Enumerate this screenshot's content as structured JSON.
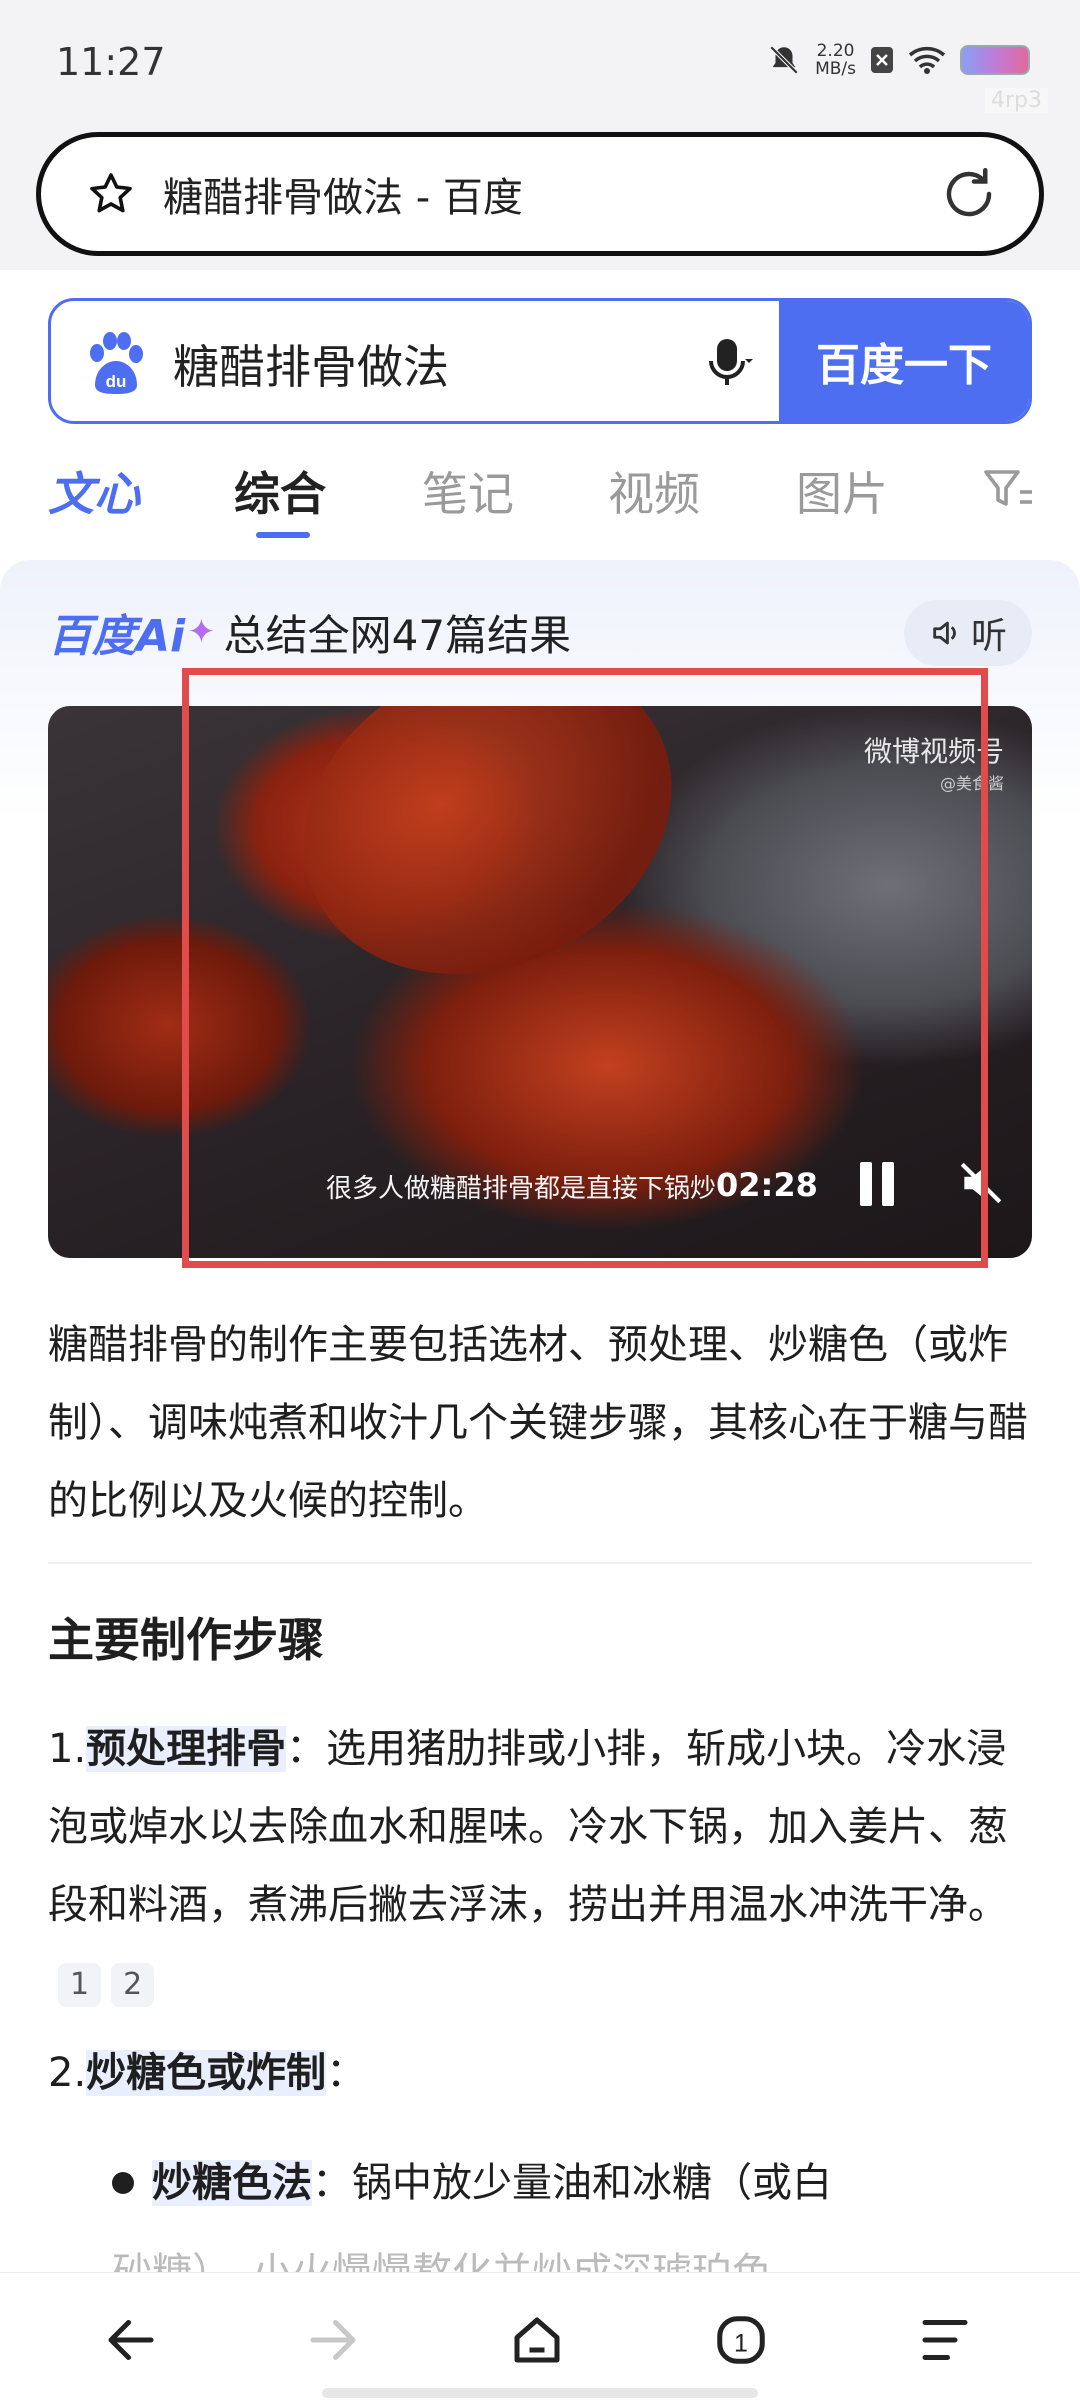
{
  "status": {
    "time": "11:27",
    "net_speed_value": "2.20",
    "net_speed_unit": "MB/s",
    "rate_tag": "4rp3"
  },
  "browser": {
    "url_title": "糖醋排骨做法 - 百度"
  },
  "search": {
    "query": "糖醋排骨做法",
    "submit_label": "百度一下"
  },
  "tabs": [
    "文心",
    "综合",
    "笔记",
    "视频",
    "图片"
  ],
  "ai": {
    "brand": "百度Ai",
    "summary": "总结全网47篇结果",
    "listen_label": "听"
  },
  "video": {
    "watermark": "微博视频号",
    "watermark_sub": "@美食酱",
    "caption": "很多人做糖醋排骨都是直接下锅炒",
    "time": "02:28"
  },
  "content": {
    "intro": "糖醋排骨的制作主要包括选材、预处理、炒糖色（或炸制）、调味炖煮和收汁几个关键步骤，其核心在于糖与醋的比例以及火候的控制。",
    "section_title": "主要制作步骤",
    "step1_num": "1.",
    "step1_title": "预处理排骨",
    "step1_text": "：选用猪肋排或小排，斩成小块。冷水浸泡或焯水以去除血水和腥味。冷水下锅，加入姜片、葱段和料酒，煮沸后撇去浮沫，捞出并用温水冲洗干净。",
    "ref1": "1",
    "ref2": "2",
    "step2_num": "2.",
    "step2_title": "炒糖色或炸制",
    "step2_colon": "：",
    "bullet1_title": "炒糖色法",
    "bullet1_text": "：锅中放少量油和冰糖（或白",
    "bullet1_cut": "砂糖），小火慢慢熬化并炒成深琥珀色"
  },
  "colors": {
    "accent": "#4e6ef2",
    "highlight": "#e24b4b"
  }
}
